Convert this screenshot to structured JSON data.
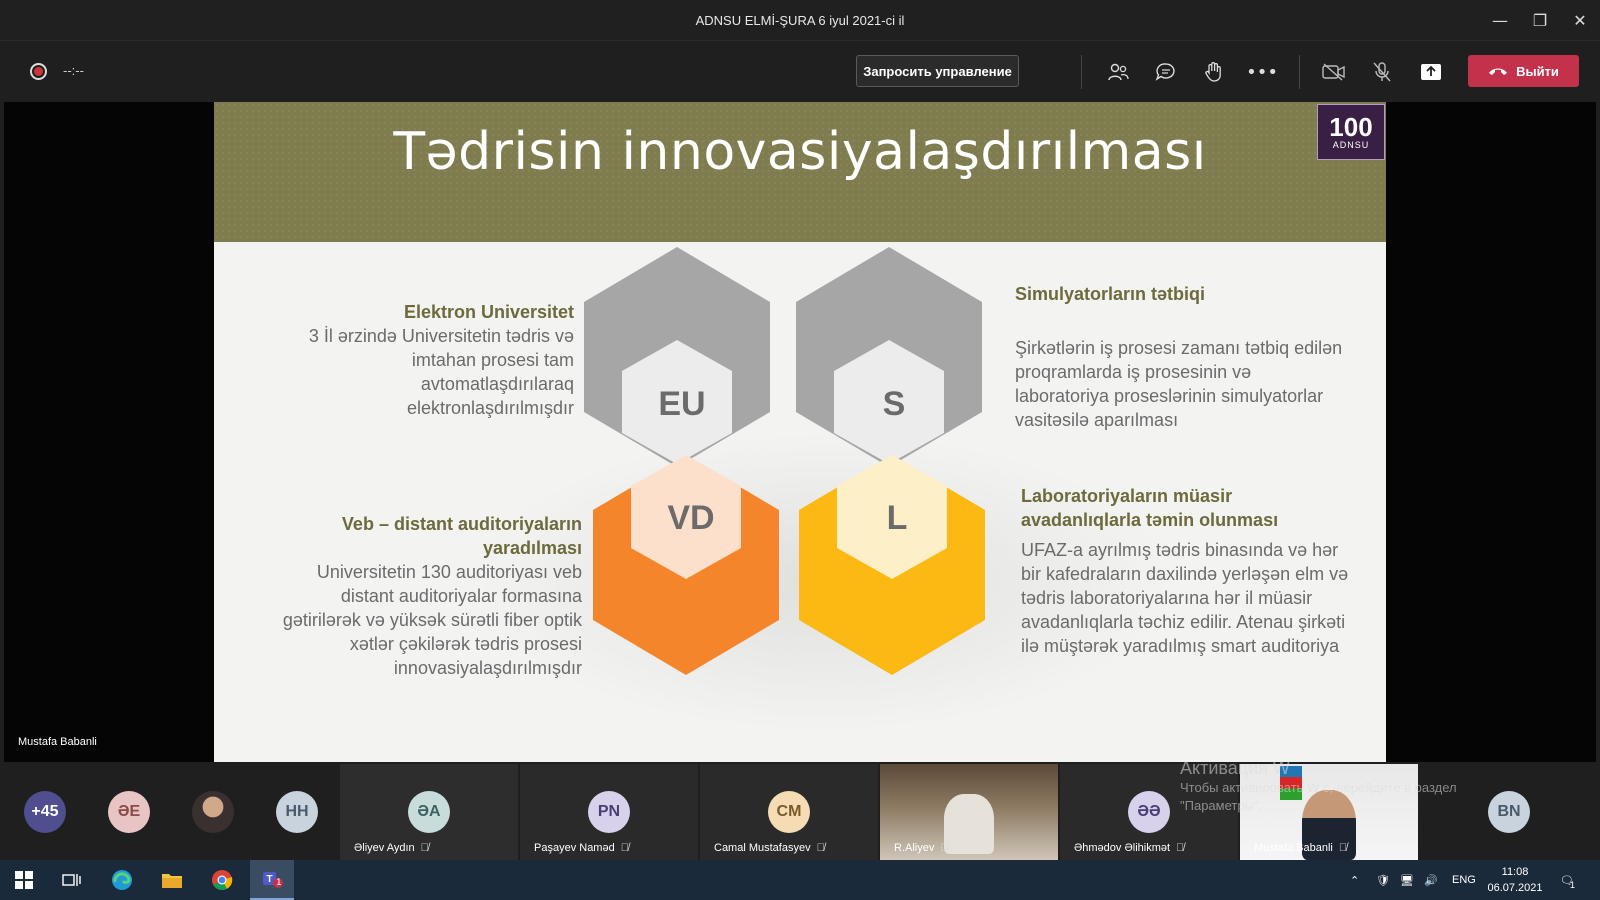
{
  "window": {
    "title": "ADNSU ELMİ-ŞURA 6 iyul 2021-ci il"
  },
  "toolbar": {
    "timer": "--:--",
    "request_control_label": "Запросить управление",
    "leave_label": "Выйти",
    "icons": [
      "people-icon",
      "chat-icon",
      "raise-hand-icon",
      "more-icon",
      "camera-off-icon",
      "mic-off-icon",
      "share-icon"
    ]
  },
  "slide": {
    "title": "Tədrisin innovasiyalaşdırılması",
    "logo_number": "100",
    "logo_text": "ADNSU",
    "eu": {
      "hex_label": "EU",
      "heading": "Elektron Universitet",
      "body": "3  İl ərzində Universitetin tədris və imtahan prosesi tam avtomatlaşdırılaraq elektronlaşdırılmışdır"
    },
    "s": {
      "hex_label": "S",
      "heading": "Simulyatorların tətbiqi",
      "body": "Şirkətlərin iş prosesi zamanı tətbiq edilən proqramlarda iş prosesinin və laboratoriya proseslərinin simulyatorlar vasitəsilə aparılması"
    },
    "vd": {
      "hex_label": "VD",
      "heading": "Veb – distant auditoriyaların yaradılması",
      "body": "Universitetin 130 auditoriyası veb distant auditoriyalar formasına gətirilərək və yüksək sürətli fiber optik xətlər çəkilərək tədris prosesi innovasiyalaşdırılmışdır"
    },
    "l": {
      "hex_label": "L",
      "heading": "Laboratoriyaların müasir avadanlıqlarla təmin olunması",
      "body": "UFAZ-a ayrılmış tədris binasında və hər bir kafedraların daxilində yerləşən elm və tədris laboratoriyalarına hər il müasir avadanlıqlarla təchiz edilir. Atenau şirkəti ilə müştərək yaradılmış smart auditoriya"
    },
    "colors": {
      "gray_hex": "#a6a6a6",
      "orange_hex": "#f5852b",
      "yellow_hex": "#fcb813",
      "header_olive": "#7f7d4f"
    }
  },
  "speaker_label": "Mustafa Babanli",
  "participants": [
    {
      "initials": "+45",
      "color": "#4f4f8f"
    },
    {
      "initials": "ƏE",
      "color": "#e8c4c4"
    },
    {
      "initials": "",
      "color": "#555",
      "photo": true
    },
    {
      "initials": "HH",
      "color": "#c9d3de"
    },
    {
      "initials": "ƏA",
      "name": "Əliyev Aydın",
      "color": "#c8dcdc"
    },
    {
      "initials": "PN",
      "name": "Paşayev Naməd",
      "color": "#d7d1ec"
    },
    {
      "initials": "CM",
      "name": "Camal Mustafasyev",
      "color": "#f5dcb4"
    },
    {
      "name": "R.Aliyev",
      "video": true
    },
    {
      "initials": "ƏƏ",
      "name": "Əhmədov Əlihikmət",
      "color": "#d7d1ec"
    },
    {
      "name": "Mustafa Babanli",
      "video": true
    },
    {
      "initials": "BN",
      "color": "#c9d3de"
    }
  ],
  "watermark": {
    "line1": "Активация W",
    "line2": "Чтобы активировать W   с, перейдите в раздел",
    "line3": "\"Параметры\"."
  },
  "taskbar": {
    "language": "ENG",
    "time": "11:08",
    "date": "06.07.2021",
    "notifications": "1",
    "teams_badge": "1"
  }
}
